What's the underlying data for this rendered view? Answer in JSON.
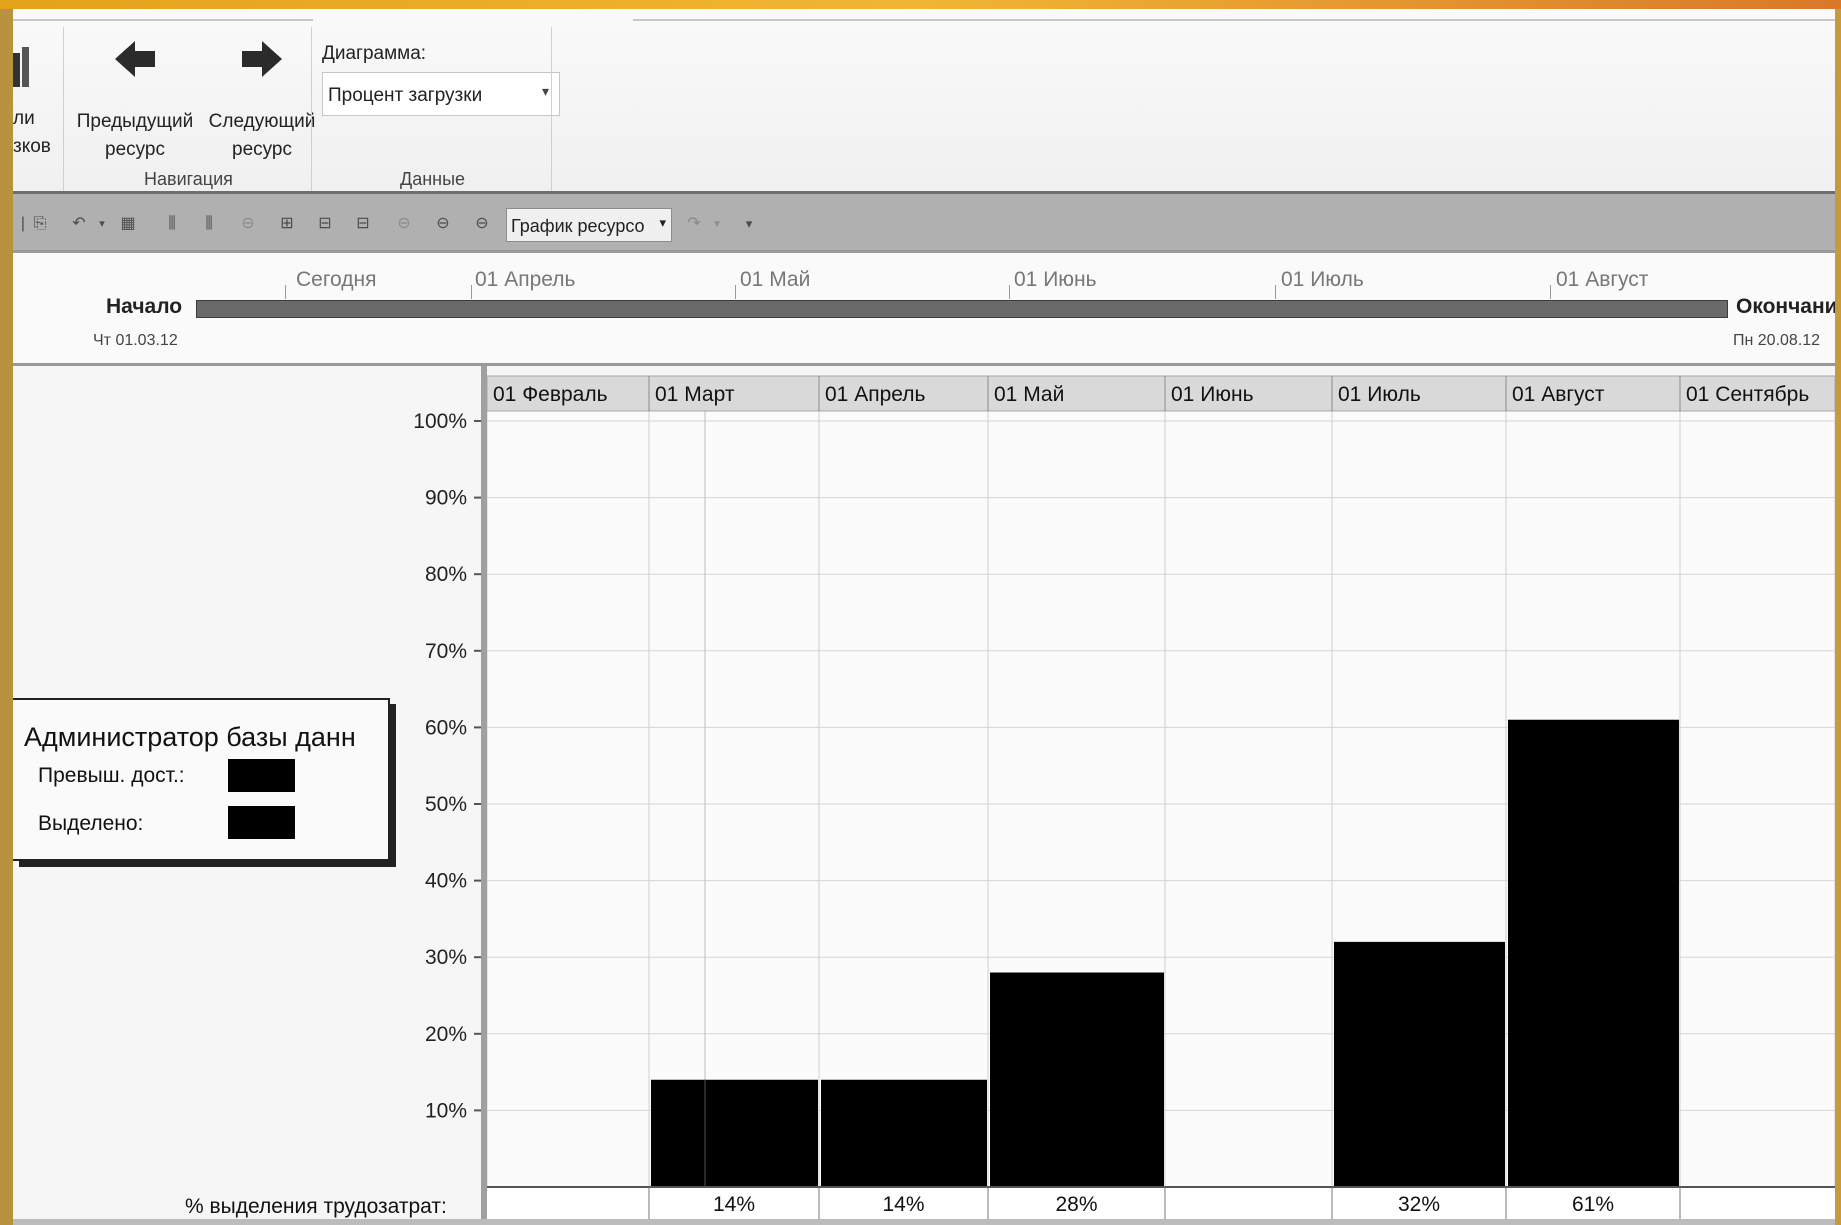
{
  "ribbon": {
    "partial_button_label_1": "ли",
    "partial_button_label_2": "зков",
    "prev_label_1": "Предыдущий",
    "prev_label_2": "ресурс",
    "next_label_1": "Следующий",
    "next_label_2": "ресурс",
    "nav_group": "Навигация",
    "diagram_label": "Диаграмма:",
    "diagram_value": "Процент загрузки",
    "data_group": "Данные"
  },
  "toolbar": {
    "view_value": "График ресурсо"
  },
  "timeline": {
    "today": "Сегодня",
    "months": [
      "01 Апрель",
      "01 Май",
      "01 Июнь",
      "01 Июль",
      "01 Август"
    ],
    "start_label": "Начало",
    "start_date": "Чт 01.03.12",
    "end_label": "Окончани",
    "end_date": "Пн 20.08.12"
  },
  "legend": {
    "title": "Администратор базы данн",
    "overalloc": "Превыш. дост.:",
    "allocated": "Выделено:"
  },
  "footer_label": "% выделения трудозатрат:",
  "chart_data": {
    "type": "bar",
    "categories": [
      "01 Февраль",
      "01 Март",
      "01 Апрель",
      "01 Май",
      "01 Июнь",
      "01 Июль",
      "01 Август",
      "01 Сентябрь"
    ],
    "values": [
      0,
      14,
      14,
      28,
      0,
      32,
      61,
      0
    ],
    "value_labels": [
      "",
      "14%",
      "14%",
      "28%",
      "",
      "32%",
      "61%",
      ""
    ],
    "y_ticks": [
      "10%",
      "20%",
      "30%",
      "40%",
      "50%",
      "60%",
      "70%",
      "80%",
      "90%",
      "100%"
    ],
    "ylim": [
      0,
      100
    ],
    "bar_color": "#000000",
    "grid": true
  }
}
